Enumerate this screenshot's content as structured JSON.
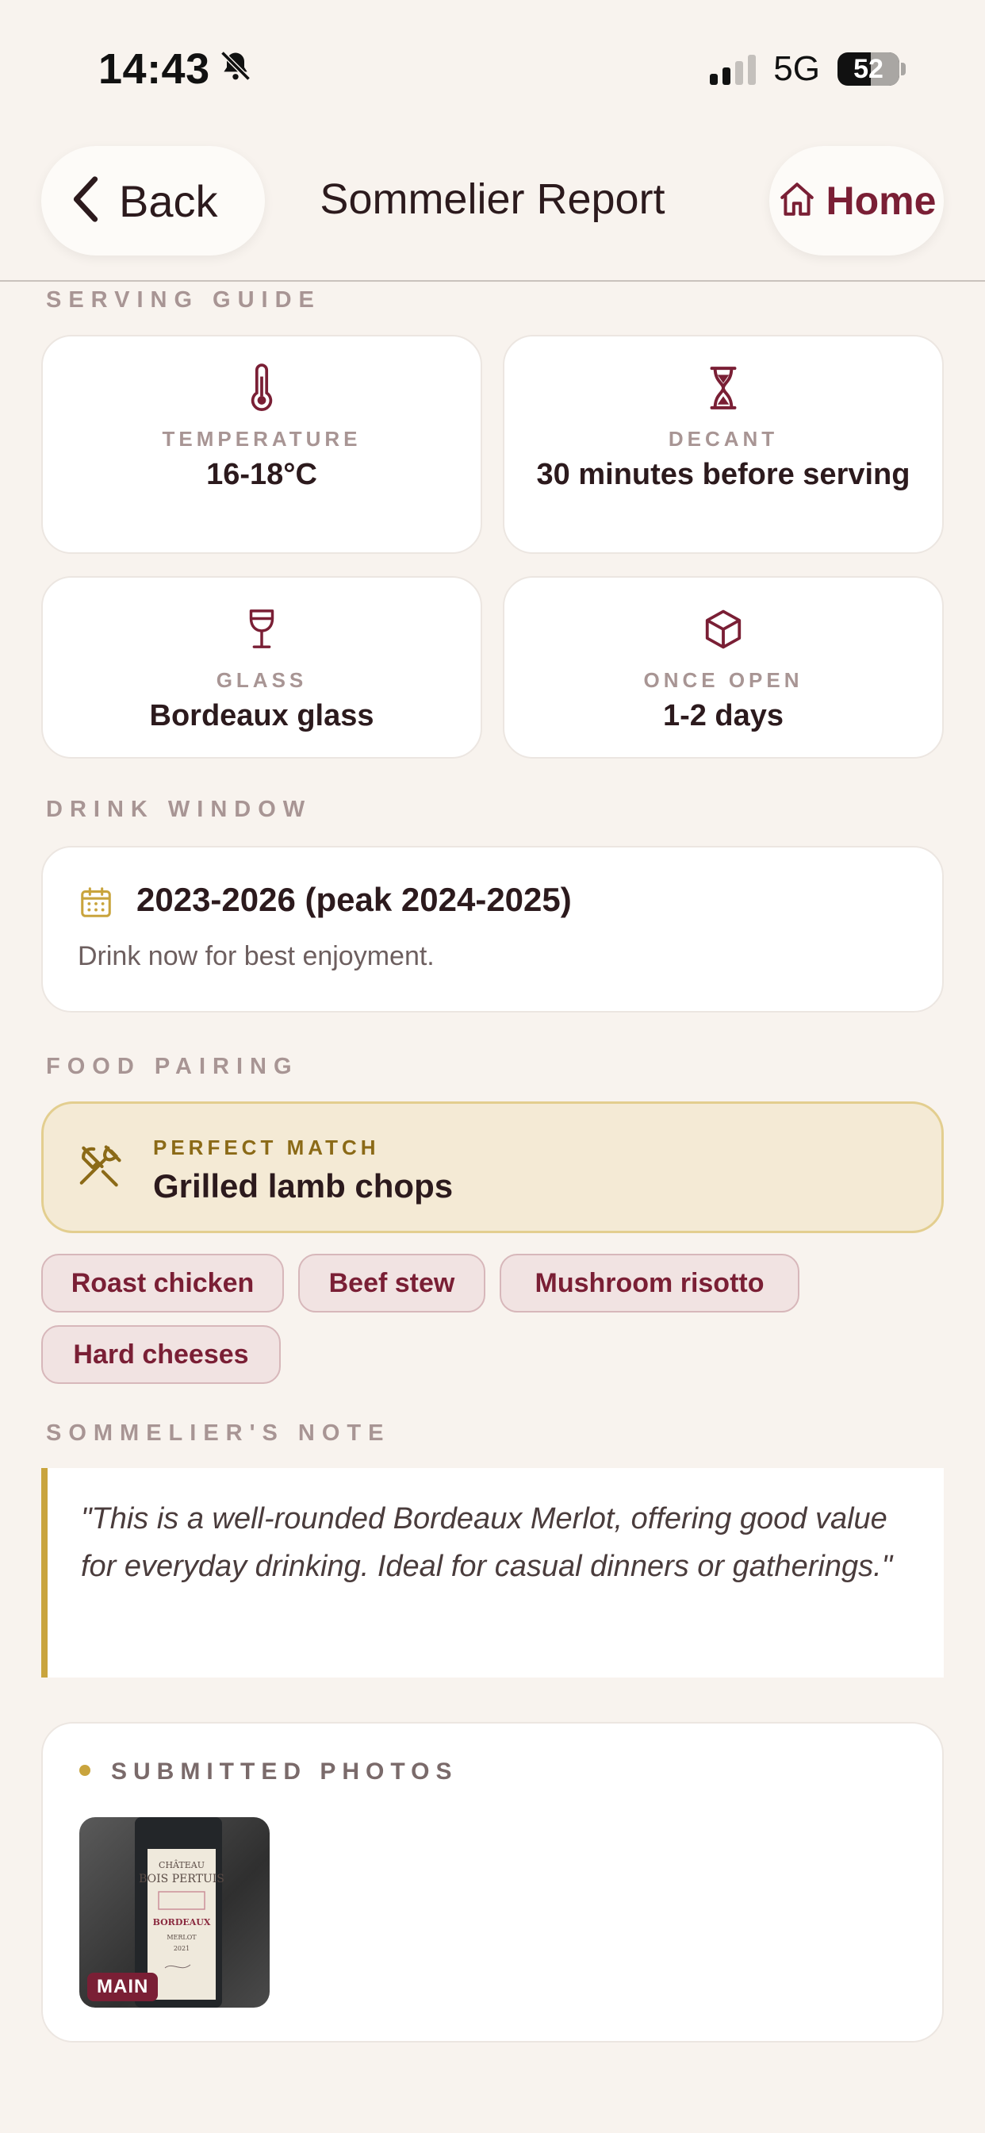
{
  "status_bar": {
    "time": "14:43",
    "network": "5G",
    "battery": "52"
  },
  "nav": {
    "back_label": "Back",
    "title": "Sommelier Report",
    "home_label": "Home"
  },
  "serving_guide": {
    "section_title": "SERVING GUIDE",
    "items": [
      {
        "icon": "thermometer-icon",
        "caption": "TEMPERATURE",
        "value": "16-18°C"
      },
      {
        "icon": "hourglass-icon",
        "caption": "DECANT",
        "value": "30 minutes before serving"
      },
      {
        "icon": "wine-glass-icon",
        "caption": "GLASS",
        "value": "Bordeaux glass"
      },
      {
        "icon": "box-icon",
        "caption": "ONCE OPEN",
        "value": "1-2 days"
      }
    ]
  },
  "drink_window": {
    "section_title": "DRINK WINDOW",
    "range": "2023-2026 (peak 2024-2025)",
    "advice": "Drink now for best enjoyment."
  },
  "food_pairing": {
    "section_title": "FOOD PAIRING",
    "perfect_caption": "PERFECT MATCH",
    "perfect_value": "Grilled lamb chops",
    "others": [
      "Roast chicken",
      "Beef stew",
      "Mushroom risotto",
      "Hard cheeses"
    ]
  },
  "sommelier_note": {
    "section_title": "SOMMELIER'S NOTE",
    "text": "\"This is a well-rounded Bordeaux Merlot, offering good value for everyday drinking. Ideal for casual dinners or gatherings.\""
  },
  "photos": {
    "section_title": "SUBMITTED PHOTOS",
    "badge": "MAIN",
    "label_lines": [
      "CHÂTEAU",
      "BOIS PERTUIS",
      "BORDEAUX",
      "MERLOT",
      "2021"
    ]
  },
  "colors": {
    "accent": "#7a1f35",
    "gold": "#c9a43d",
    "background": "#f8f3ee"
  }
}
